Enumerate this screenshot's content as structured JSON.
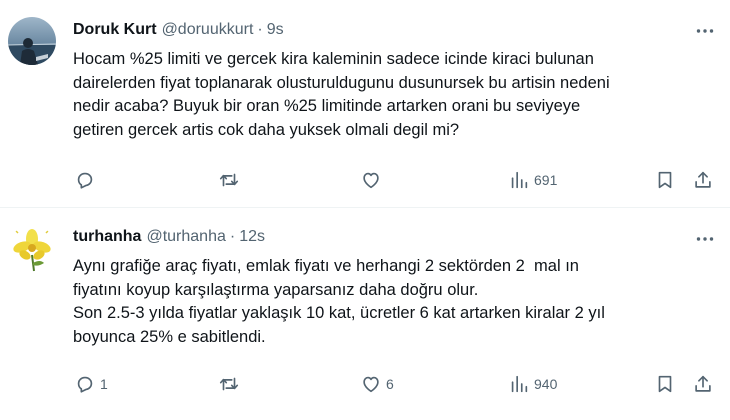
{
  "tweets": [
    {
      "name": "Doruk Kurt",
      "handle": "@doruukkurt",
      "separator": "·",
      "time": "9s",
      "text": "Hocam %25 limiti ve gercek kira kaleminin sadece icinde kiraci bulunan\ndairelerden fiyat toplanarak olusturuldugunu dusunursek bu artisin nedeni\nnedir acaba? Buyuk bir oran %25 limitinde artarken orani bu seviyeye\ngetiren gercek artis cok daha yuksek olmali degil mi?",
      "replies": "",
      "retweets": "",
      "likes": "",
      "views": "691",
      "avatar_icon": "photo-avatar"
    },
    {
      "name": "turhanha",
      "handle": "@turhanha",
      "separator": "·",
      "time": "12s",
      "text": "Aynı grafiğe araç fiyatı, emlak fiyatı ve herhangi 2 sektörden 2  mal ın\nfiyatını koyup karşılaştırma yaparsanız daha doğru olur.\nSon 2.5-3 yılda fiyatlar yaklaşık 10 kat, ücretler 6 kat artarken kiralar 2 yıl\nboyunca 25% e sabitlendi.",
      "replies": "1",
      "retweets": "",
      "likes": "6",
      "views": "940",
      "avatar_icon": "flower-avatar"
    }
  ],
  "icons": {
    "reply": "reply-icon",
    "retweet": "retweet-icon",
    "like": "heart-icon",
    "views": "views-icon",
    "bookmark": "bookmark-icon",
    "share": "share-icon",
    "more": "more-icon"
  },
  "colors": {
    "text": "#0f1419",
    "secondary": "#536471",
    "divider": "#eff3f4",
    "background": "#ffffff"
  }
}
